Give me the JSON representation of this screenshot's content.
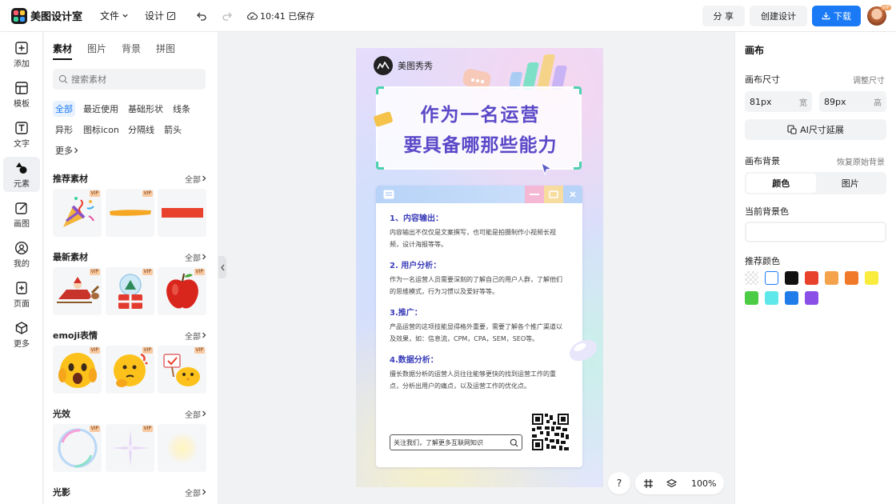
{
  "app": {
    "name": "美图设计室",
    "menu_file": "文件",
    "menu_design": "设计",
    "saved_status": "10:41 已保存",
    "share": "分 享",
    "create_design": "创建设计",
    "download": "下载",
    "avatar_badge": "VIP"
  },
  "leftnav": {
    "items": [
      {
        "label": "添加",
        "icon": "plus-square-icon"
      },
      {
        "label": "模板",
        "icon": "template-icon"
      },
      {
        "label": "文字",
        "icon": "text-icon"
      },
      {
        "label": "元素",
        "icon": "shapes-icon"
      },
      {
        "label": "画图",
        "icon": "draw-icon"
      },
      {
        "label": "我的",
        "icon": "user-icon"
      },
      {
        "label": "页面",
        "icon": "page-add-icon"
      },
      {
        "label": "更多",
        "icon": "cube-icon"
      }
    ],
    "active_index": 3
  },
  "panel": {
    "tabs": [
      "素材",
      "图片",
      "背景",
      "拼图"
    ],
    "search_placeholder": "搜索素材",
    "chips": [
      "全部",
      "最近使用",
      "基础形状",
      "线条",
      "异形",
      "图标icon",
      "分隔线",
      "箭头",
      "更多"
    ],
    "all_label": "全部",
    "vip": "VIP",
    "sections": [
      {
        "title": "推荐素材"
      },
      {
        "title": "最新素材"
      },
      {
        "title": "emoji表情"
      },
      {
        "title": "光效"
      },
      {
        "title": "光影"
      }
    ]
  },
  "poster": {
    "brand": "美图秀秀",
    "title_line1": "作为一名运营",
    "title_line2": "要具备哪那些能力",
    "items": [
      {
        "heading": "1、内容输出：",
        "body": "内容输出不仅仅是文案撰写，也可能是拍摄制作小视频长视频，设计海报等等。"
      },
      {
        "heading": "2. 用户分析：",
        "body": "作为一名运营人员需要深刻的了解自己的用户人群，了解他们的思维模式，行为习惯以及爱好等等。"
      },
      {
        "heading": "3.推广：",
        "body": "产品运营的这项技能显得格外重要，需要了解各个推广渠道以及效果，如：信息流，CPM，CPA，SEM，SEO等。"
      },
      {
        "heading": "4.数据分析：",
        "body": "擅长数据分析的运营人员往往能够更快的找到运营工作的重点，分析出用户的痛点，以及运营工作的优化点。"
      }
    ],
    "follow": "关注我们，了解更多互联网知识"
  },
  "canvas_tools": {
    "help": "?",
    "zoom": "100%"
  },
  "rpanel": {
    "title": "画布",
    "size_label": "画布尺寸",
    "adjust": "调整尺寸",
    "width_value": "81px",
    "width_unit": "宽",
    "height_value": "89px",
    "height_unit": "高",
    "ai_extend": "AI尺寸延展",
    "bg_label": "画布背景",
    "restore_bg": "恢复原始背景",
    "seg_color": "颜色",
    "seg_image": "图片",
    "current_bg": "当前背景色",
    "recommended": "推荐颜色",
    "swatches": [
      "transparent",
      "#ffffff",
      "#111111",
      "#e8412c",
      "#f4a24b",
      "#f07a2a",
      "#f9ec3c",
      "#4ccc44",
      "#5ee8ea",
      "#1f7ce8",
      "#8a4fe6"
    ]
  },
  "colors": {
    "accent": "#1a7af5",
    "title_purple": "#5a48c8",
    "heading_blue": "#3a3db8"
  }
}
